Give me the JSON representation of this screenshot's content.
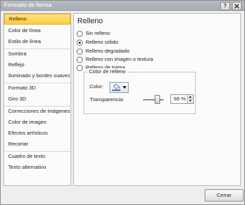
{
  "window": {
    "title": "Formato de forma",
    "help_label": "?",
    "close_label": "×"
  },
  "sidebar": {
    "items": [
      {
        "label": "Relleno",
        "active": true
      },
      {
        "label": "Color de línea"
      },
      {
        "label": "Estilo de línea"
      },
      {
        "label": "Sombra"
      },
      {
        "label": "Reflejo"
      },
      {
        "label": "Iluminado y bordes suaves"
      },
      {
        "label": "Formato 3D"
      },
      {
        "label": "Giro 3D"
      },
      {
        "label": "Correcciones de imágenes"
      },
      {
        "label": "Color de imagen"
      },
      {
        "label": "Efectos artísticos"
      },
      {
        "label": "Recortar"
      },
      {
        "label": "Cuadro de texto"
      },
      {
        "label": "Texto alternativo"
      }
    ]
  },
  "panel": {
    "title": "Relleno",
    "options": [
      {
        "label": "Sin relleno",
        "selected": false
      },
      {
        "label": "Relleno sólido",
        "selected": true
      },
      {
        "label": "Relleno degradado",
        "selected": false
      },
      {
        "label": "Relleno con imagen o textura",
        "selected": false
      },
      {
        "label": "Relleno de trama",
        "selected": false
      }
    ],
    "group": {
      "title": "Color de relleno",
      "color_label": "Color:",
      "transparency_label": "Transparencia:",
      "transparency_value": "66 %",
      "transparency_level": 0.66
    }
  },
  "footer": {
    "close_button": "Cerrar"
  }
}
